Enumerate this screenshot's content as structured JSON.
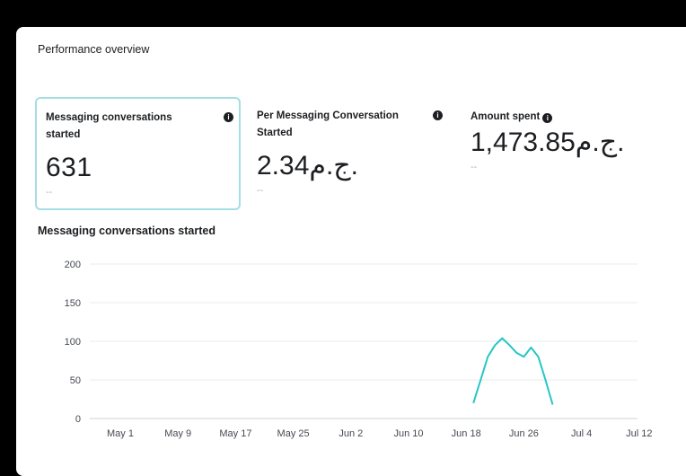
{
  "header": {
    "title": "Performance overview"
  },
  "metrics": [
    {
      "label": "Messaging conversations started",
      "value": "631",
      "sub": "--",
      "selected": true
    },
    {
      "label": "Per Messaging Conversation Started",
      "value": "2.34ج.م.",
      "sub": "--"
    },
    {
      "label": "Amount spent",
      "value": "1,473.85ج.م.",
      "sub": "--"
    }
  ],
  "info_icon": "info-icon",
  "chart_title": "Messaging conversations started",
  "chart_data": {
    "type": "line",
    "title": "Messaging conversations started",
    "xlabel": "",
    "ylabel": "",
    "ylim": [
      0,
      200
    ],
    "yticks": [
      0,
      50,
      100,
      150,
      200
    ],
    "xticks": [
      "May 1",
      "May 9",
      "May 17",
      "May 25",
      "Jun 2",
      "Jun 10",
      "Jun 18",
      "Jun 26",
      "Jul 4",
      "Jul 12"
    ],
    "grid": true,
    "series": [
      {
        "color": "#26c6c6",
        "points": [
          {
            "x": "Jun 19",
            "y": 20
          },
          {
            "x": "Jun 20",
            "y": 50
          },
          {
            "x": "Jun 21",
            "y": 80
          },
          {
            "x": "Jun 22",
            "y": 95
          },
          {
            "x": "Jun 23",
            "y": 104
          },
          {
            "x": "Jun 24",
            "y": 95
          },
          {
            "x": "Jun 25",
            "y": 85
          },
          {
            "x": "Jun 26",
            "y": 80
          },
          {
            "x": "Jun 27",
            "y": 92
          },
          {
            "x": "Jun 28",
            "y": 80
          },
          {
            "x": "Jun 29",
            "y": 50
          },
          {
            "x": "Jun 30",
            "y": 18
          }
        ]
      }
    ]
  }
}
